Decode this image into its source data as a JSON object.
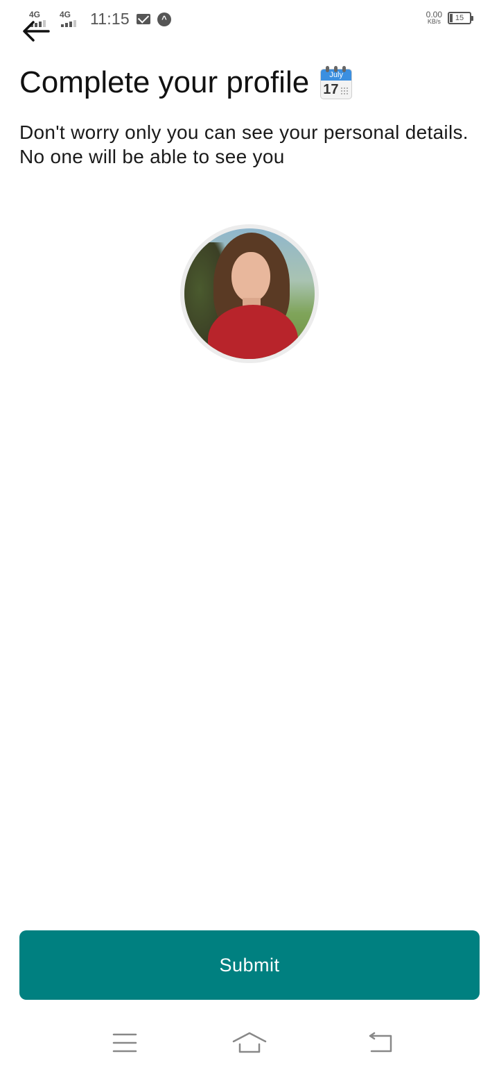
{
  "status_bar": {
    "network_1": "4G",
    "network_2": "4G",
    "time": "11:15",
    "speed_value": "0.00",
    "speed_unit": "KB/s",
    "battery": "15",
    "icons": [
      "mail-icon",
      "app-notification-icon"
    ]
  },
  "header": {
    "back_icon": "arrow-left-icon"
  },
  "main": {
    "title": "Complete your profile",
    "title_emoji": {
      "icon": "calendar-icon",
      "month": "July",
      "day": "17"
    },
    "subtitle": "Don't worry only you can see your personal details. No one will be able to see you",
    "avatar": "profile-photo"
  },
  "actions": {
    "submit_label": "Submit",
    "submit_color": "#008080"
  },
  "nav_bar": {
    "icons": [
      "menu-icon",
      "home-icon",
      "back-icon"
    ]
  }
}
